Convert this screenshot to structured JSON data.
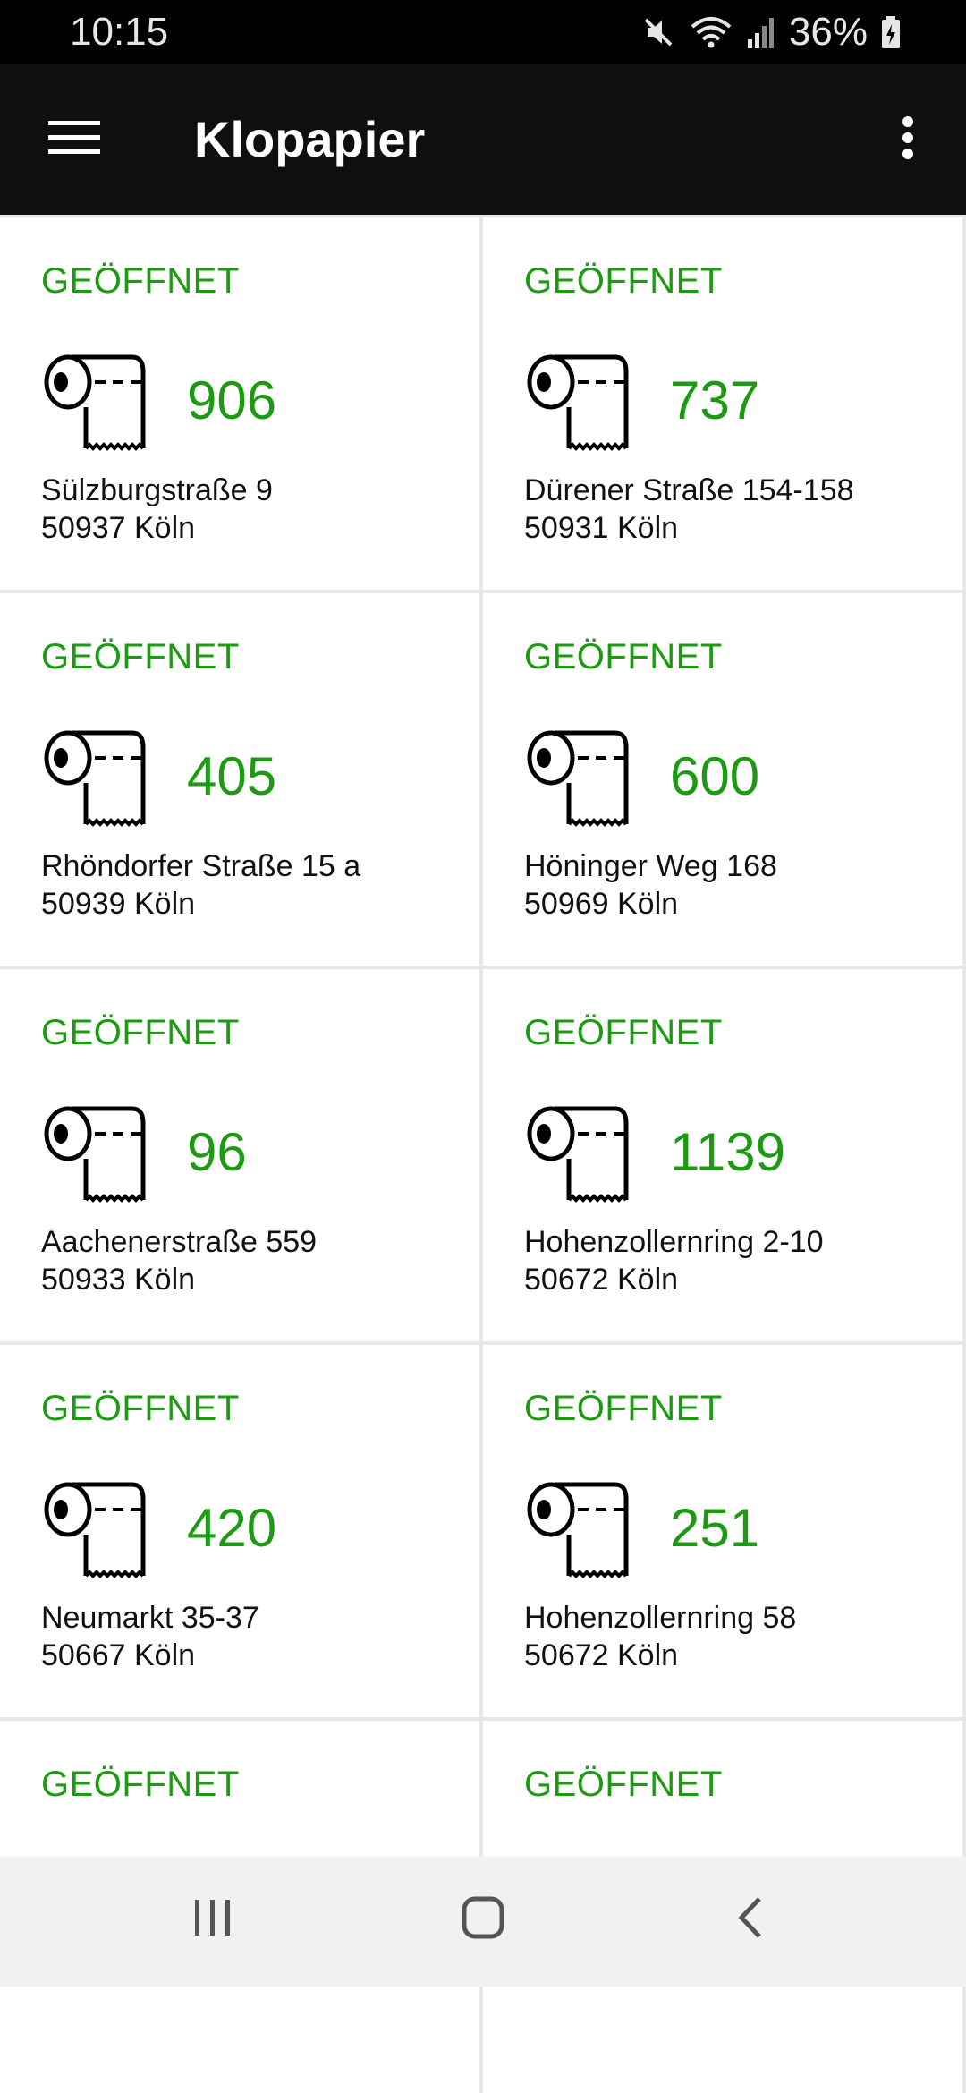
{
  "status_bar": {
    "time": "10:15",
    "battery": "36%",
    "icons": [
      "mute-icon",
      "wifi-icon",
      "signal-icon",
      "battery-charging-icon"
    ]
  },
  "app_bar": {
    "title": "Klopapier",
    "menu_icon": "hamburger-menu-icon",
    "overflow_icon": "more-vert-icon"
  },
  "colors": {
    "accent_green": "#1c9a12",
    "app_bar": "#0f0f0f"
  },
  "cards": [
    {
      "status": "GEÖFFNET",
      "count": "906",
      "street": "Sülzburgstraße 9",
      "city": "50937 Köln"
    },
    {
      "status": "GEÖFFNET",
      "count": "737",
      "street": "Dürener Straße 154-158",
      "city": "50931 Köln"
    },
    {
      "status": "GEÖFFNET",
      "count": "405",
      "street": "Rhöndorfer Straße 15 a",
      "city": "50939 Köln"
    },
    {
      "status": "GEÖFFNET",
      "count": "600",
      "street": "Höninger Weg 168",
      "city": "50969 Köln"
    },
    {
      "status": "GEÖFFNET",
      "count": "96",
      "street": "Aachenerstraße 559",
      "city": "50933 Köln"
    },
    {
      "status": "GEÖFFNET",
      "count": "1139",
      "street": "Hohenzollernring 2-10",
      "city": "50672 Köln"
    },
    {
      "status": "GEÖFFNET",
      "count": "420",
      "street": "Neumarkt 35-37",
      "city": "50667 Köln"
    },
    {
      "status": "GEÖFFNET",
      "count": "251",
      "street": "Hohenzollernring 58",
      "city": "50672 Köln"
    },
    {
      "status": "GEÖFFNET"
    },
    {
      "status": "GEÖFFNET"
    }
  ],
  "nav_bar": {
    "icons": [
      "recent-apps-icon",
      "home-icon",
      "back-icon"
    ]
  }
}
